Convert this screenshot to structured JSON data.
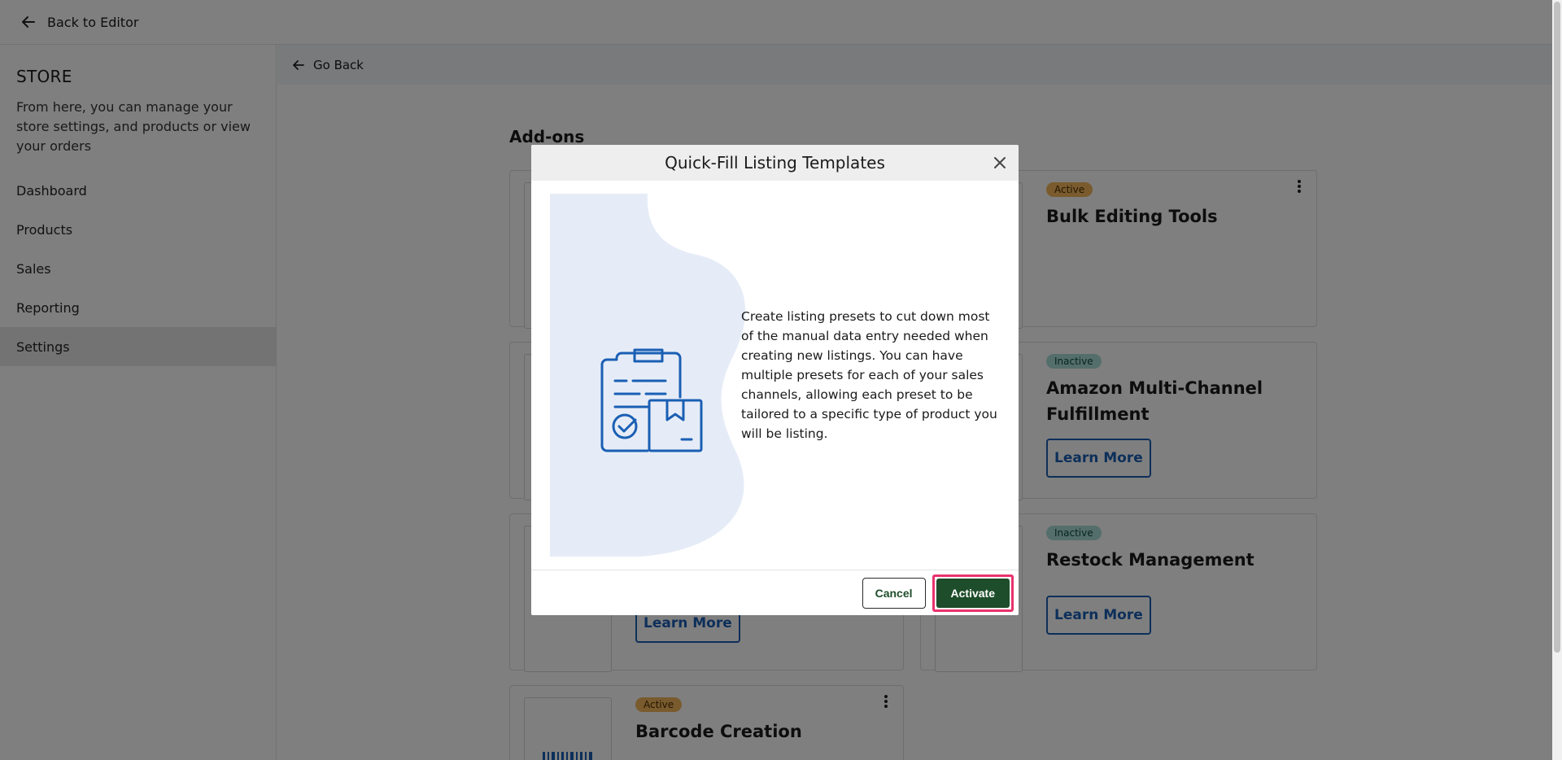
{
  "topbar": {
    "back_label": "Back to Editor"
  },
  "sidebar": {
    "title": "STORE",
    "description": "From here, you can manage your store settings, and products or view your orders",
    "items": [
      {
        "label": "Dashboard"
      },
      {
        "label": "Products"
      },
      {
        "label": "Sales"
      },
      {
        "label": "Reporting"
      },
      {
        "label": "Settings",
        "active": true
      }
    ]
  },
  "main": {
    "go_back_label": "Go Back",
    "section_title": "Add-ons",
    "cards": [
      {
        "status": "Active",
        "title": "Bulk Editing Tools"
      },
      {
        "status": "Inactive",
        "title": "Amazon Multi-Channel Fulfillment",
        "button": "Learn More"
      },
      {
        "button": "Learn More"
      },
      {
        "status": "Inactive",
        "title": "Restock Management",
        "button": "Learn More"
      },
      {
        "status": "Active",
        "title": "Barcode Creation"
      }
    ]
  },
  "modal": {
    "title": "Quick-Fill Listing Templates",
    "description": "Create listing presets to cut down most of the manual data entry needed when creating new listings. You can have multiple presets for each of your sales channels, allowing each preset to be tailored to a specific type of product you will be listing.",
    "cancel_label": "Cancel",
    "activate_label": "Activate"
  },
  "colors": {
    "accent_blue": "#1a5fb4",
    "activate_green": "#1d4d2a",
    "highlight_pink": "#e8336d",
    "badge_active": "#f3b65c",
    "badge_inactive": "#a9ddd7",
    "blob_fill": "#e6ecf7"
  }
}
